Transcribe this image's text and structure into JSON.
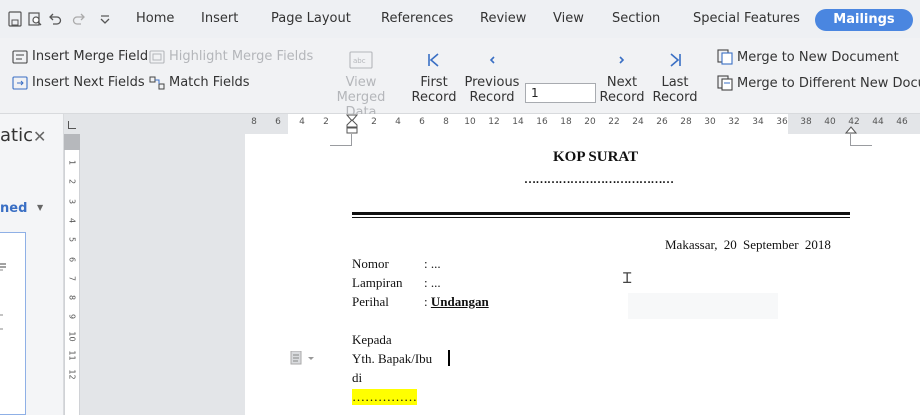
{
  "menubar": {
    "tabs": [
      "Home",
      "Insert",
      "Page Layout",
      "References",
      "Review",
      "View",
      "Section",
      "Special Features"
    ],
    "active_tab": "Mailings",
    "accent_color": "#4a86e0"
  },
  "ribbon": {
    "insert_merge_field": "Insert Merge Field",
    "insert_next_fields": "Insert Next Fields",
    "highlight_merge_fields": "Highlight Merge Fields",
    "match_fields": "Match Fields",
    "view_merged_data_1": "View",
    "view_merged_data_2": "Merged Data",
    "first_record_1": "First",
    "first_record_2": "Record",
    "previous_record_1": "Previous",
    "previous_record_2": "Record",
    "record_value": "1",
    "next_record_1": "Next",
    "next_record_2": "Record",
    "last_record_1": "Last",
    "last_record_2": "Record",
    "merge_to_new_document": "Merge to New Document",
    "merge_to_different_document": "Merge to Different New Docum"
  },
  "ruler": {
    "labels": [
      "8",
      "6",
      "4",
      "2",
      "2",
      "4",
      "6",
      "8",
      "10",
      "12",
      "14",
      "16",
      "18",
      "20",
      "22",
      "24",
      "26",
      "28",
      "30",
      "32",
      "34",
      "36",
      "38",
      "40",
      "42",
      "44",
      "46"
    ],
    "vertical_labels": [
      "1",
      "2",
      "3",
      "4",
      "5",
      "6",
      "7",
      "8",
      "9",
      "10",
      "11",
      "12"
    ]
  },
  "left_panel": {
    "title": "atic",
    "selector": "ned"
  },
  "document": {
    "heading": "KOP SURAT",
    "heading_dots": "…………………………………",
    "date": "Makassar,  20  September  2018",
    "nomor_label": "Nomor",
    "nomor_value": ": ...",
    "lampiran_label": "Lampiran",
    "lampiran_value": ": ...",
    "perihal_label": "Perihal",
    "perihal_colon": ": ",
    "perihal_value": "Undangan",
    "kepada": "Kepada",
    "yth": "Yth. Bapak/Ibu",
    "di": "di",
    "address_dots": "……………",
    "highlight_color": "#ffff00"
  }
}
